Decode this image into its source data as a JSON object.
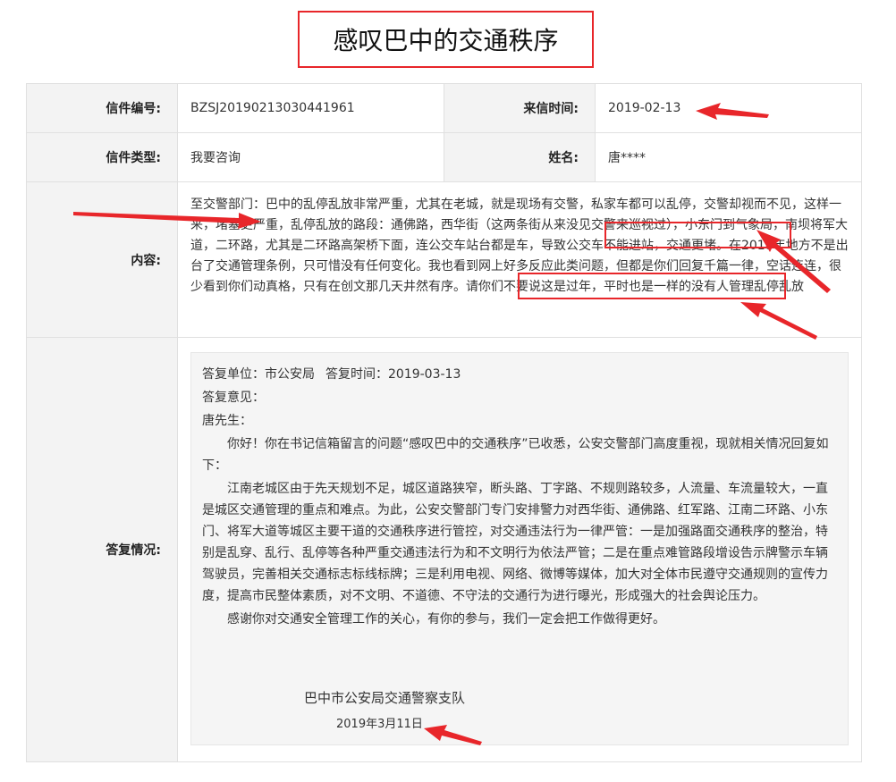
{
  "title": "感叹巴中的交通秩序",
  "fields": {
    "letter_no_label": "信件编号:",
    "letter_no": "BZSJ20190213030441961",
    "letter_time_label": "来信时间:",
    "letter_time": "2019-02-13",
    "letter_type_label": "信件类型:",
    "letter_type": "我要咨询",
    "name_label": "姓名:",
    "name": "唐****",
    "content_label": "内容:",
    "reply_label": "答复情况:"
  },
  "content": {
    "p1": "至交警部门：巴中的乱停乱放非常严重，尤其在老城，就是现场有交警，私家车都可以乱停，交警却视而不见，这样一来，堵塞更严重，乱停乱放的路段：通佛路，西华街（这两条街从来没见交警来巡视过），",
    "p2": "小东门到气象局，南坝将军大道，",
    "p3": "二环路，尤其是二环路高架桥下面，连公交车站台都是车，导致公交车不能进站，交通更堵。在2018年地方不是出台了交通管理条例，只可惜没有任何变化。我也看到网上好多反应此类问题，但都是",
    "p4": "你们回复千篇一律，空话连连，很少看到你们动真格，",
    "p5": "只有在创文那几天井然有序。请你们不要说这是过年，平时也是一样的没有人管理乱停乱放"
  },
  "reply": {
    "unit": "答复单位：市公安局",
    "time": "答复时间：2019-03-13",
    "opinion_label": "答复意见：",
    "greeting": "唐先生：",
    "para1": "你好！你在书记信箱留言的问题“感叹巴中的交通秩序”已收悉，公安交警部门高度重视，现就相关情况回复如下：",
    "para2": "江南老城区由于先天规划不足，城区道路狭窄，断头路、丁字路、不规则路较多，人流量、车流量较大，一直是城区交通管理的重点和难点。为此，公安交警部门专门安排警力对西华街、通佛路、红军路、江南二环路、小东门、将军大道等城区主要干道的交通秩序进行管控，对交通违法行为一律严管：一是加强路面交通秩序的整治，特别是乱穿、乱行、乱停等各种严重交通违法行为和不文明行为依法严管；二是在重点难管路段增设告示牌警示车辆驾驶员，完善相关交通标志标线标牌；三是利用电视、网络、微博等媒体，加大对全体市民遵守交通规则的宣传力度，提高市民整体素质，对不文明、不道德、不守法的交通行为进行曝光，形成强大的社会舆论压力。",
    "para3": "感谢你对交通安全管理工作的关心，有你的参与，我们一定会把工作做得更好。",
    "signature": "巴中市公安局交通警察支队",
    "sign_date": "2019年3月11日"
  },
  "colors": {
    "accent": "#e8262a",
    "label_bg": "#f3f3f3",
    "border": "#e0e0e0",
    "reply_bg": "#f5f5f5"
  }
}
